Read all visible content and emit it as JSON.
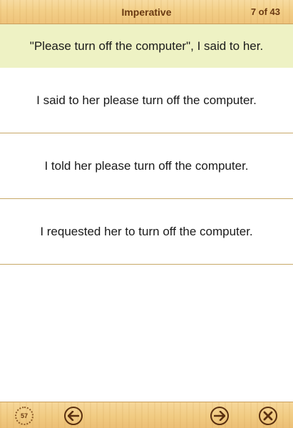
{
  "header": {
    "title": "Imperative",
    "counter": "7 of 43"
  },
  "question": {
    "text": "\"Please turn off the computer\", I said to her."
  },
  "answers": [
    {
      "text": "I said to her please turn off the computer."
    },
    {
      "text": "I told her please turn off the computer."
    },
    {
      "text": "I requested her to turn off the computer."
    }
  ],
  "footer": {
    "timer_value": "57",
    "timer_icon": "stopwatch-icon",
    "prev_icon": "arrow-left-icon",
    "next_icon": "arrow-right-icon",
    "close_icon": "close-icon"
  },
  "colors": {
    "header_text": "#6a3a12",
    "question_bg": "#eef2c4",
    "divider": "#c7a868",
    "icon": "#5a3010"
  }
}
